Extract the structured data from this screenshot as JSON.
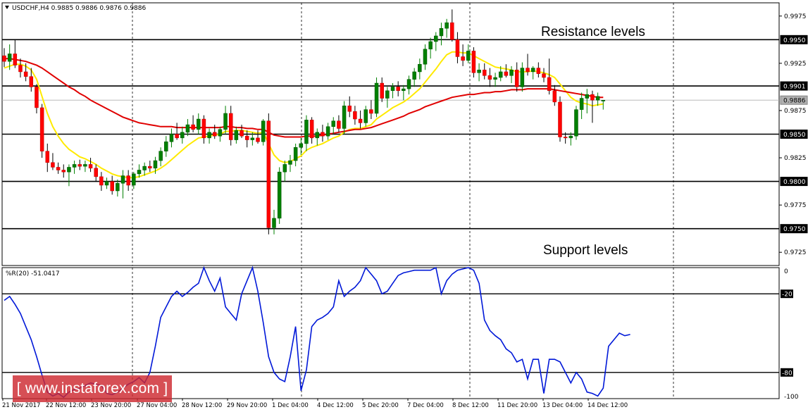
{
  "chart_data": [
    {
      "type": "candlestick",
      "symbol_line": "USDCHF,H4  0.9885 0.9886 0.9876 0.9886",
      "ylim": [
        0.9711,
        0.9989
      ],
      "y_ticks": [
        "0.9975",
        "0.9925",
        "0.9875",
        "0.9825",
        "0.9775",
        "0.9725"
      ],
      "price_labels": [
        {
          "text": "0.9950",
          "value": 0.995
        },
        {
          "text": "0.9901",
          "value": 0.9901
        },
        {
          "text": "0.9886",
          "value": 0.9886
        },
        {
          "text": "0.9850",
          "value": 0.985
        },
        {
          "text": "0.9800",
          "value": 0.98
        },
        {
          "text": "0.9750",
          "value": 0.975
        }
      ],
      "horizontal_levels": [
        0.995,
        0.9901,
        0.985,
        0.98,
        0.975
      ],
      "current_price": 0.9886,
      "annotations": [
        "Resistance levels",
        "Support levels"
      ],
      "x_labels": [
        "21 Nov 2017",
        "22 Nov 12:00",
        "23 Nov 20:00",
        "27 Nov 04:00",
        "28 Nov 12:00",
        "29 Nov 20:00",
        "1 Dec 04:00",
        "4 Dec 12:00",
        "5 Dec 20:00",
        "7 Dec 04:00",
        "8 Dec 12:00",
        "11 Dec 20:00",
        "13 Dec 04:00",
        "14 Dec 12:00"
      ],
      "candles": [
        [
          0.9933,
          0.9941,
          0.9921,
          0.9927
        ],
        [
          0.9927,
          0.9945,
          0.9918,
          0.9935
        ],
        [
          0.9935,
          0.995,
          0.992,
          0.9923
        ],
        [
          0.9923,
          0.993,
          0.991,
          0.9916
        ],
        [
          0.9916,
          0.9925,
          0.9906,
          0.9911
        ],
        [
          0.9911,
          0.992,
          0.9895,
          0.99
        ],
        [
          0.99,
          0.9903,
          0.9872,
          0.9878
        ],
        [
          0.9878,
          0.9882,
          0.9825,
          0.9832
        ],
        [
          0.9832,
          0.984,
          0.981,
          0.982
        ],
        [
          0.982,
          0.983,
          0.9812,
          0.9815
        ],
        [
          0.9815,
          0.982,
          0.9808,
          0.9812
        ],
        [
          0.9812,
          0.9818,
          0.9804,
          0.981
        ],
        [
          0.981,
          0.9818,
          0.9795,
          0.9815
        ],
        [
          0.9815,
          0.9822,
          0.9808,
          0.9818
        ],
        [
          0.9818,
          0.9823,
          0.9812,
          0.9816
        ],
        [
          0.9816,
          0.9822,
          0.981,
          0.9818
        ],
        [
          0.9818,
          0.9825,
          0.981,
          0.9814
        ],
        [
          0.9814,
          0.9818,
          0.98,
          0.9805
        ],
        [
          0.9805,
          0.981,
          0.979,
          0.9796
        ],
        [
          0.9796,
          0.9804,
          0.9792,
          0.98
        ],
        [
          0.98,
          0.9806,
          0.9786,
          0.979
        ],
        [
          0.979,
          0.9802,
          0.9784,
          0.9798
        ],
        [
          0.9798,
          0.9812,
          0.9782,
          0.9806
        ],
        [
          0.9806,
          0.9812,
          0.979,
          0.9796
        ],
        [
          0.9796,
          0.981,
          0.9792,
          0.9808
        ],
        [
          0.9808,
          0.9818,
          0.9804,
          0.9812
        ],
        [
          0.9812,
          0.982,
          0.9806,
          0.9816
        ],
        [
          0.9816,
          0.9822,
          0.981,
          0.9814
        ],
        [
          0.9814,
          0.9826,
          0.9808,
          0.9822
        ],
        [
          0.9822,
          0.9836,
          0.9816,
          0.9832
        ],
        [
          0.9832,
          0.9848,
          0.9826,
          0.9842
        ],
        [
          0.9842,
          0.9856,
          0.9836,
          0.985
        ],
        [
          0.985,
          0.9862,
          0.9844,
          0.9846
        ],
        [
          0.9846,
          0.9858,
          0.984,
          0.9852
        ],
        [
          0.9852,
          0.9866,
          0.9848,
          0.986
        ],
        [
          0.986,
          0.987,
          0.9852,
          0.9855
        ],
        [
          0.9855,
          0.9872,
          0.985,
          0.9866
        ],
        [
          0.9866,
          0.987,
          0.984,
          0.9846
        ],
        [
          0.9846,
          0.9856,
          0.984,
          0.9852
        ],
        [
          0.9852,
          0.986,
          0.9845,
          0.9848
        ],
        [
          0.9848,
          0.9858,
          0.9842,
          0.9855
        ],
        [
          0.9855,
          0.988,
          0.985,
          0.9872
        ],
        [
          0.9872,
          0.988,
          0.9838,
          0.9844
        ],
        [
          0.9844,
          0.9858,
          0.984,
          0.9854
        ],
        [
          0.9854,
          0.986,
          0.9846,
          0.9848
        ],
        [
          0.9848,
          0.9854,
          0.9836,
          0.9844
        ],
        [
          0.9844,
          0.9852,
          0.9838,
          0.9846
        ],
        [
          0.9846,
          0.9854,
          0.984,
          0.9842
        ],
        [
          0.9842,
          0.9866,
          0.9838,
          0.9864
        ],
        [
          0.9864,
          0.9872,
          0.9744,
          0.9751
        ],
        [
          0.9751,
          0.977,
          0.9744,
          0.9761
        ],
        [
          0.9761,
          0.9815,
          0.9755,
          0.981
        ],
        [
          0.981,
          0.9822,
          0.98,
          0.9818
        ],
        [
          0.9818,
          0.9828,
          0.981,
          0.9822
        ],
        [
          0.9822,
          0.984,
          0.9816,
          0.9836
        ],
        [
          0.9836,
          0.9846,
          0.9828,
          0.984
        ],
        [
          0.984,
          0.987,
          0.9832,
          0.9865
        ],
        [
          0.9865,
          0.9868,
          0.984,
          0.9846
        ],
        [
          0.9846,
          0.9856,
          0.9838,
          0.9852
        ],
        [
          0.9852,
          0.986,
          0.9842,
          0.9848
        ],
        [
          0.9848,
          0.9862,
          0.9844,
          0.9858
        ],
        [
          0.9858,
          0.9868,
          0.985,
          0.9864
        ],
        [
          0.9864,
          0.987,
          0.9852,
          0.9856
        ],
        [
          0.9856,
          0.9885,
          0.985,
          0.988
        ],
        [
          0.988,
          0.989,
          0.9868,
          0.9874
        ],
        [
          0.9874,
          0.988,
          0.986,
          0.9866
        ],
        [
          0.9866,
          0.9875,
          0.9856,
          0.9862
        ],
        [
          0.9862,
          0.988,
          0.9858,
          0.9876
        ],
        [
          0.9876,
          0.9886,
          0.9866,
          0.9872
        ],
        [
          0.9872,
          0.991,
          0.9868,
          0.9904
        ],
        [
          0.9904,
          0.991,
          0.9884,
          0.9888
        ],
        [
          0.9888,
          0.99,
          0.9878,
          0.9896
        ],
        [
          0.9896,
          0.9904,
          0.9888,
          0.99
        ],
        [
          0.99,
          0.9906,
          0.989,
          0.9896
        ],
        [
          0.9896,
          0.9902,
          0.9886,
          0.9898
        ],
        [
          0.9898,
          0.9912,
          0.9892,
          0.9908
        ],
        [
          0.9908,
          0.992,
          0.99,
          0.9916
        ],
        [
          0.9916,
          0.993,
          0.9908,
          0.9924
        ],
        [
          0.9924,
          0.9945,
          0.9918,
          0.994
        ],
        [
          0.994,
          0.9952,
          0.993,
          0.9948
        ],
        [
          0.9948,
          0.9958,
          0.9938,
          0.9954
        ],
        [
          0.9954,
          0.9968,
          0.9944,
          0.9962
        ],
        [
          0.9962,
          0.9972,
          0.9952,
          0.9968
        ],
        [
          0.9968,
          0.9982,
          0.9948,
          0.995
        ],
        [
          0.995,
          0.9958,
          0.9925,
          0.9932
        ],
        [
          0.9932,
          0.9945,
          0.9922,
          0.9928
        ],
        [
          0.9928,
          0.9945,
          0.9925,
          0.9938
        ],
        [
          0.9938,
          0.9942,
          0.991,
          0.9915
        ],
        [
          0.9915,
          0.9925,
          0.9906,
          0.9918
        ],
        [
          0.9918,
          0.9925,
          0.9908,
          0.9912
        ],
        [
          0.9912,
          0.992,
          0.99,
          0.9908
        ],
        [
          0.9908,
          0.9915,
          0.99,
          0.991
        ],
        [
          0.991,
          0.9922,
          0.9906,
          0.9916
        ],
        [
          0.9916,
          0.9924,
          0.991,
          0.9912
        ],
        [
          0.9912,
          0.9922,
          0.9904,
          0.9918
        ],
        [
          0.9918,
          0.9926,
          0.9895,
          0.99
        ],
        [
          0.99,
          0.9926,
          0.9895,
          0.992
        ],
        [
          0.992,
          0.9935,
          0.9912,
          0.9916
        ],
        [
          0.9916,
          0.9922,
          0.9908,
          0.992
        ],
        [
          0.992,
          0.9926,
          0.991,
          0.9914
        ],
        [
          0.9914,
          0.992,
          0.9905,
          0.991
        ],
        [
          0.991,
          0.993,
          0.9892,
          0.9896
        ],
        [
          0.9896,
          0.9902,
          0.988,
          0.9884
        ],
        [
          0.9884,
          0.989,
          0.9842,
          0.9847
        ],
        [
          0.9847,
          0.9852,
          0.984,
          0.9846
        ],
        [
          0.9846,
          0.9852,
          0.9838,
          0.9848
        ],
        [
          0.9848,
          0.988,
          0.9844,
          0.9876
        ],
        [
          0.9876,
          0.9894,
          0.9866,
          0.9888
        ],
        [
          0.9888,
          0.9898,
          0.9872,
          0.9892
        ],
        [
          0.9892,
          0.9896,
          0.9862,
          0.9886
        ],
        [
          0.9886,
          0.9894,
          0.988,
          0.989
        ],
        [
          0.9885,
          0.9886,
          0.9876,
          0.9886
        ]
      ],
      "series": [
        {
          "name": "",
          "color": "#ffea00",
          "values": [
            0.992,
            0.9922,
            0.9924,
            0.9924,
            0.9922,
            0.9918,
            0.9908,
            0.989,
            0.9872,
            0.9858,
            0.9848,
            0.984,
            0.9834,
            0.983,
            0.9826,
            0.9824,
            0.9821,
            0.9818,
            0.9814,
            0.9811,
            0.9808,
            0.9806,
            0.9805,
            0.9804,
            0.9804,
            0.9805,
            0.9807,
            0.9809,
            0.9811,
            0.9814,
            0.9818,
            0.9823,
            0.9828,
            0.9833,
            0.9838,
            0.9842,
            0.9846,
            0.9847,
            0.9848,
            0.9849,
            0.985,
            0.9853,
            0.9853,
            0.9854,
            0.9854,
            0.9853,
            0.9852,
            0.9851,
            0.9852,
            0.984,
            0.9828,
            0.9822,
            0.982,
            0.9821,
            0.9824,
            0.9827,
            0.9833,
            0.9836,
            0.9838,
            0.984,
            0.9843,
            0.9846,
            0.9848,
            0.9852,
            0.9855,
            0.9856,
            0.9856,
            0.9858,
            0.986,
            0.9866,
            0.987,
            0.9874,
            0.9878,
            0.9881,
            0.9884,
            0.9888,
            0.9893,
            0.9898,
            0.9905,
            0.9912,
            0.9919,
            0.9927,
            0.9934,
            0.9937,
            0.9937,
            0.9936,
            0.9936,
            0.9933,
            0.993,
            0.9927,
            0.9924,
            0.9921,
            0.992,
            0.9919,
            0.9918,
            0.9916,
            0.9916,
            0.9916,
            0.9917,
            0.9916,
            0.9915,
            0.9913,
            0.991,
            0.9903,
            0.9896,
            0.9889,
            0.9885,
            0.9883,
            0.9882,
            0.988,
            0.9881,
            0.9882
          ]
        },
        {
          "name": "",
          "color": "#e00000",
          "values": [
            0.993,
            0.993,
            0.9929,
            0.9928,
            0.9927,
            0.9925,
            0.9923,
            0.992,
            0.9916,
            0.9912,
            0.9908,
            0.9904,
            0.99,
            0.9897,
            0.9893,
            0.989,
            0.9886,
            0.9883,
            0.988,
            0.9877,
            0.9874,
            0.9871,
            0.9868,
            0.9866,
            0.9864,
            0.9862,
            0.9861,
            0.986,
            0.9859,
            0.9858,
            0.9858,
            0.9858,
            0.9857,
            0.9857,
            0.9857,
            0.9857,
            0.9857,
            0.9857,
            0.9857,
            0.9857,
            0.9857,
            0.9858,
            0.9858,
            0.9857,
            0.9857,
            0.9856,
            0.9856,
            0.9855,
            0.9855,
            0.9852,
            0.9849,
            0.9848,
            0.9847,
            0.9847,
            0.9847,
            0.9847,
            0.9848,
            0.9848,
            0.9848,
            0.9849,
            0.985,
            0.9851,
            0.9852,
            0.9853,
            0.9854,
            0.9855,
            0.9855,
            0.9856,
            0.9857,
            0.9859,
            0.9861,
            0.9863,
            0.9865,
            0.9867,
            0.9869,
            0.9872,
            0.9874,
            0.9876,
            0.9879,
            0.9881,
            0.9883,
            0.9885,
            0.9887,
            0.9889,
            0.989,
            0.9891,
            0.9892,
            0.9892,
            0.9893,
            0.9894,
            0.9894,
            0.9895,
            0.9895,
            0.9896,
            0.9897,
            0.9897,
            0.9897,
            0.9898,
            0.9898,
            0.9898,
            0.9898,
            0.9898,
            0.9897,
            0.9896,
            0.9895,
            0.9894,
            0.9893,
            0.9892,
            0.9891,
            0.989,
            0.9889,
            0.9889
          ]
        }
      ]
    },
    {
      "type": "line",
      "label": "%R(20) -51.0417",
      "ylim": [
        -100,
        0
      ],
      "y_ticks": [
        "0",
        "-100"
      ],
      "level_labels": [
        {
          "text": "-20",
          "value": -20
        },
        {
          "text": "-80",
          "value": -80
        }
      ],
      "levels": [
        -20,
        -80
      ],
      "series": [
        {
          "name": "",
          "color": "#0018d8",
          "values": [
            -25,
            -22,
            -28,
            -35,
            -45,
            -55,
            -68,
            -82,
            -95,
            -98,
            -96,
            -99,
            -95,
            -93,
            -92,
            -90,
            -88,
            -89,
            -90,
            -96,
            -97,
            -95,
            -92,
            -89,
            -87,
            -84,
            -88,
            -80,
            -60,
            -38,
            -30,
            -22,
            -18,
            -22,
            -19,
            -15,
            -12,
            0,
            -10,
            -18,
            -8,
            -30,
            -35,
            -40,
            -20,
            -10,
            0,
            -18,
            -42,
            -68,
            -80,
            -85,
            -87,
            -68,
            -45,
            -94,
            -78,
            -45,
            -40,
            -38,
            -35,
            -30,
            -10,
            -22,
            -18,
            -15,
            -10,
            0,
            -5,
            -10,
            -20,
            -18,
            -12,
            -6,
            -4,
            -3,
            -2,
            -2,
            -2,
            -2,
            0,
            -20,
            -10,
            -5,
            -2,
            -1,
            0,
            -2,
            -12,
            -40,
            -48,
            -52,
            -55,
            -62,
            -65,
            -72,
            -70,
            -85,
            -70,
            -70,
            -96,
            -70,
            -70,
            -72,
            -80,
            -88,
            -80,
            -85,
            -95,
            -96,
            -98,
            -92,
            -60,
            -55,
            -50,
            -52,
            -51
          ]
        }
      ]
    }
  ],
  "watermark": "[ www.instaforex.com ]"
}
